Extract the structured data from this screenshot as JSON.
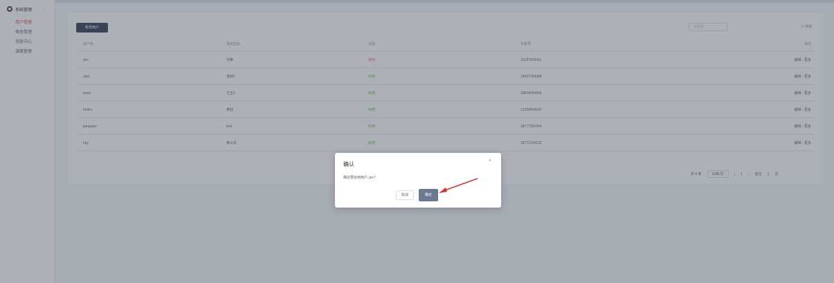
{
  "sidebar": {
    "title": "系统管理",
    "items": [
      {
        "label": "用户管理"
      },
      {
        "label": "角色管理"
      },
      {
        "label": "消息中心"
      },
      {
        "label": "调度管理"
      }
    ]
  },
  "toolbar": {
    "add_label": "新增用户",
    "filter_placeholder": "请选择",
    "refresh_label": "刷新"
  },
  "table": {
    "headers": [
      "用户名",
      "真实姓名",
      "状态",
      "手机号",
      "操作"
    ],
    "rows": [
      {
        "username": "ykx",
        "realname": "刘某",
        "status": "禁用",
        "phone": "15187243411",
        "action": "编辑 · 更多"
      },
      {
        "username": "allal",
        "realname": "李四1",
        "status": "启用",
        "phone": "15927783988",
        "action": "编辑 · 更多"
      },
      {
        "username": "wsss",
        "realname": "王五1",
        "status": "启用",
        "phone": "18844094566",
        "action": "编辑 · 更多"
      },
      {
        "username": "hellen",
        "realname": "黄钰",
        "status": "启用",
        "phone": "13159469522",
        "action": "编辑 · 更多"
      },
      {
        "username": "jiangxian",
        "realname": "test",
        "status": "启用",
        "phone": "18777301944",
        "action": "编辑 · 更多"
      },
      {
        "username": "hpy",
        "realname": "黄公兵",
        "status": "启用",
        "phone": "18772134122",
        "action": "编辑 · 更多"
      }
    ]
  },
  "pagination": {
    "total": "共 6 条",
    "page_size": "10条/页",
    "page": "1",
    "goto_label": "前往",
    "goto_page": "1",
    "page_suffix": "页"
  },
  "dialog": {
    "title": "确认",
    "message": "确定要启用用户 ykx?",
    "cancel_label": "取消",
    "confirm_label": "确定"
  },
  "colors": {
    "sidebar_active": "#e94b3c",
    "primary_dark": "#2e3a4f",
    "status_red": "#f56c6c",
    "status_green": "#67c23a",
    "arrow": "#e0302a"
  }
}
